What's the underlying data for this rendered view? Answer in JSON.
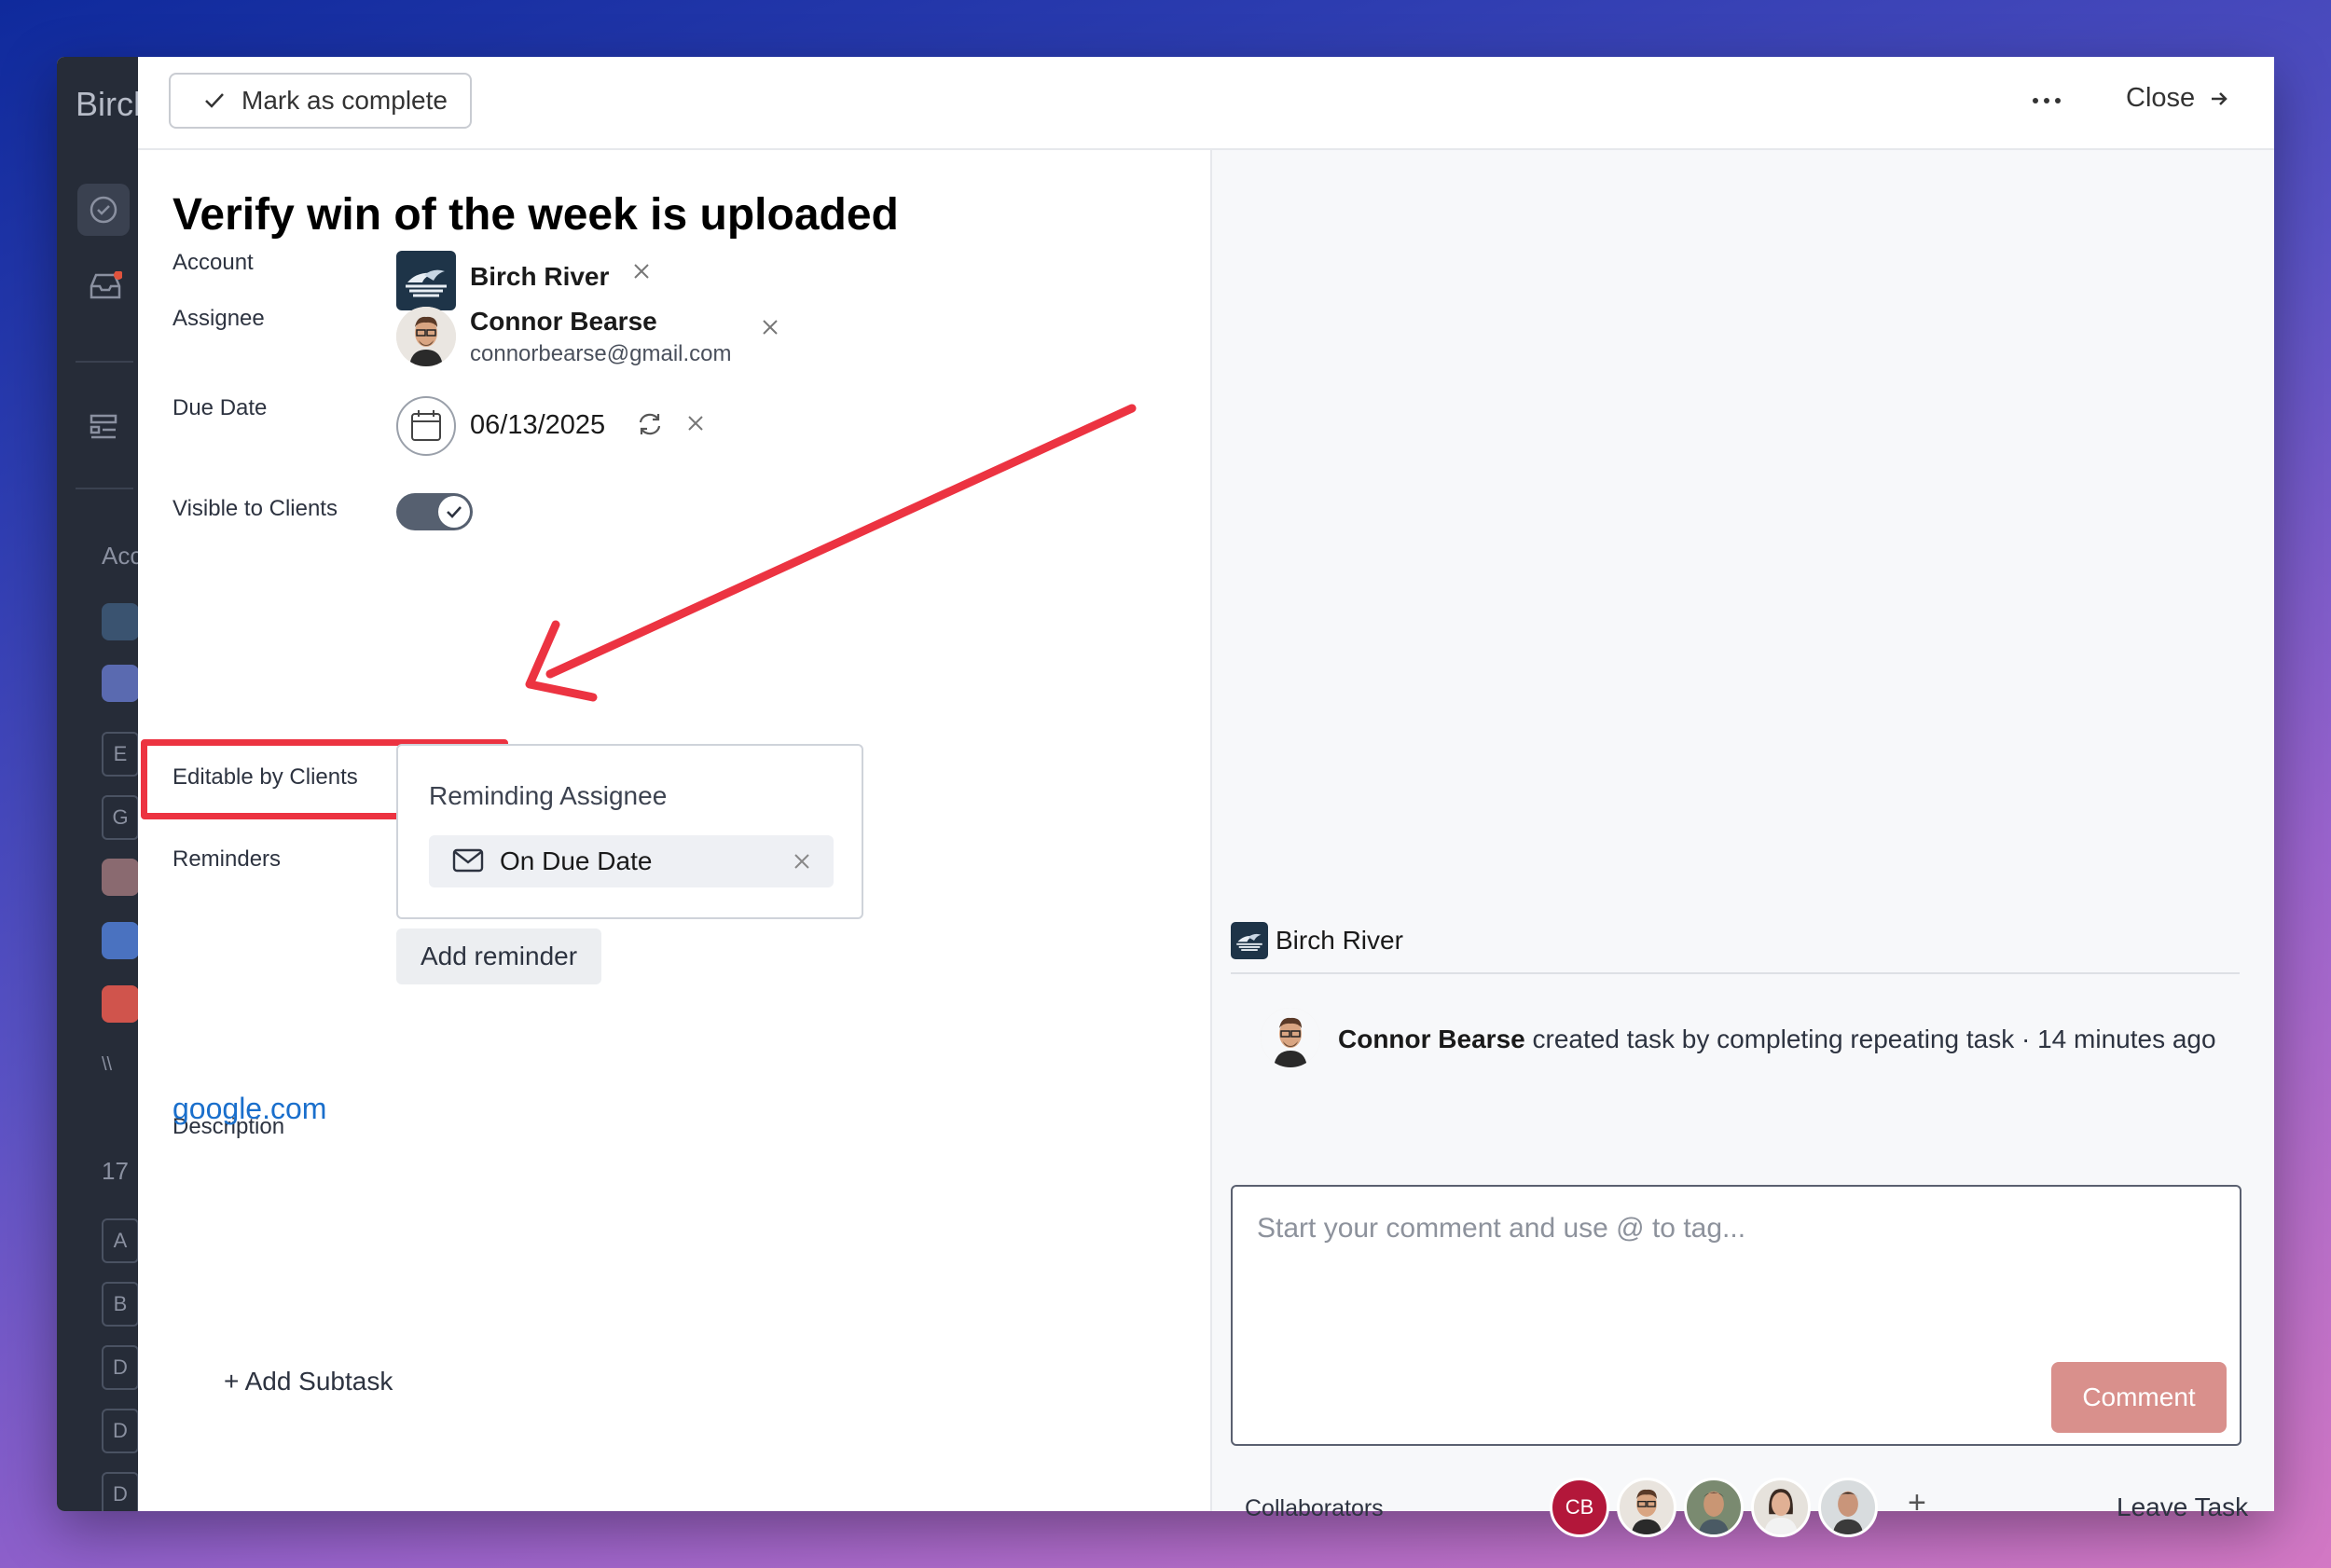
{
  "background_app": {
    "brand": "Birch",
    "sidebar_section_label": "Acc",
    "sidebar_count": "17",
    "sidebar_letters": [
      "E",
      "G",
      "A",
      "B",
      "D",
      "D",
      "D"
    ]
  },
  "toolbar": {
    "mark_complete_label": "Mark as complete",
    "close_label": "Close"
  },
  "task": {
    "title": "Verify win of the week is uploaded",
    "fields": {
      "account_label": "Account",
      "account_name": "Birch River",
      "assignee_label": "Assignee",
      "assignee_name": "Connor Bearse",
      "assignee_email": "connorbearse@gmail.com",
      "due_date_label": "Due Date",
      "due_date_value": "06/13/2025",
      "visible_label": "Visible to Clients",
      "visible_enabled": true,
      "editable_label": "Editable by Clients",
      "editable_enabled": true,
      "reminders_label": "Reminders",
      "reminder_card_title": "Reminding Assignee",
      "reminder_item": "On Due Date",
      "add_reminder_label": "Add reminder",
      "description_label": "Description",
      "description_link": "google.com"
    },
    "add_subtask_label": "+ Add Subtask"
  },
  "activity_panel": {
    "account_name": "Birch River",
    "entry_actor": "Connor Bearse",
    "entry_text": " created task by completing repeating task · 14 minutes ago",
    "comment_placeholder": "Start your comment and use @ to tag...",
    "comment_button": "Comment",
    "collaborators_label": "Collaborators",
    "collaborator_initials": "CB",
    "add_collaborator": "+",
    "leave_task_label": "Leave Task"
  },
  "colors": {
    "highlight": "#ec3341",
    "toggle_on": "#566070",
    "comment_button": "#d9908c",
    "link": "#1a6fcc",
    "collaborator_cb": "#b3173a"
  }
}
